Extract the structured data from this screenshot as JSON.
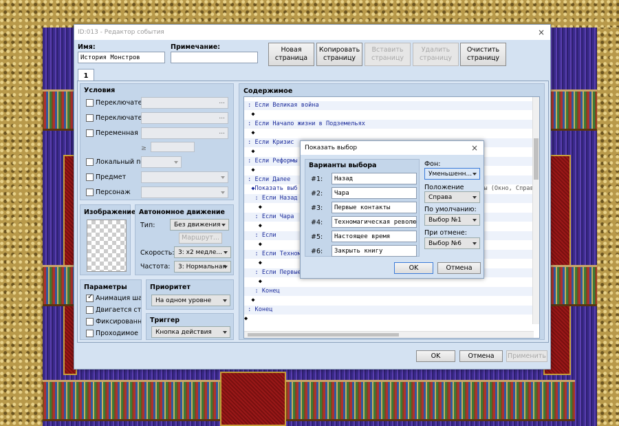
{
  "window": {
    "title": "ID:013 - Редактор события",
    "close": "×"
  },
  "name": {
    "label": "Имя:",
    "value": "История Монстров"
  },
  "note": {
    "label": "Примечание:",
    "value": ""
  },
  "page_buttons": [
    {
      "label": "Новая\nстраница",
      "enabled": true
    },
    {
      "label": "Копировать\nстраницу",
      "enabled": true
    },
    {
      "label": "Вставить\nстраницу",
      "enabled": false
    },
    {
      "label": "Удалить\nстраницу",
      "enabled": false
    },
    {
      "label": "Очистить\nстраницу",
      "enabled": true
    }
  ],
  "tab": "1",
  "conditions": {
    "title": "Условия",
    "switch1": "Переключатель",
    "switch2": "Переключатель",
    "variable": "Переменная",
    "ge": "≥",
    "self_switch": "Локальный пере",
    "item": "Предмет",
    "actor": "Персонаж",
    "dots": "..."
  },
  "image": {
    "title": "Изображение"
  },
  "autonomous": {
    "title": "Автономное движение",
    "type_label": "Тип:",
    "type_value": "Без движения",
    "route": "Маршрут...",
    "speed_label": "Скорость:",
    "speed_value": "3: x2 медле...",
    "freq_label": "Частота:",
    "freq_value": "3: Нормальная"
  },
  "options": {
    "title": "Параметры",
    "items": [
      {
        "label": "Анимация шага",
        "checked": true
      },
      {
        "label": "Двигается стоя",
        "checked": false
      },
      {
        "label": "Фиксированное",
        "checked": false
      },
      {
        "label": "Проходимое",
        "checked": false
      }
    ]
  },
  "priority": {
    "title": "Приоритет",
    "value": "На одном уровне"
  },
  "trigger": {
    "title": "Триггер",
    "value": "Кнопка действия"
  },
  "contents": {
    "title": "Содержимое",
    "rows": [
      {
        "text": "  ◆",
        "bul": true
      },
      {
        "text": " : Если Великая война"
      },
      {
        "text": "  ◆",
        "bul": true
      },
      {
        "text": " : Если Начало жизни в Подземельях"
      },
      {
        "text": "  ◆",
        "bul": true
      },
      {
        "text": " : Если Кризис"
      },
      {
        "text": "  ◆",
        "bul": true
      },
      {
        "text": " : Если Реформы к"
      },
      {
        "text": "  ◆",
        "bul": true
      },
      {
        "text": " : Если Далее"
      },
      {
        "text": "  ◆Показать выб",
        "tail": "кты (Окно, Справ"
      },
      {
        "text": "   : Если Назад"
      },
      {
        "text": "    ◆",
        "bul": true
      },
      {
        "text": "   : Если Чара"
      },
      {
        "text": "    ◆",
        "bul": true
      },
      {
        "text": "   : Если"
      },
      {
        "text": "    ◆",
        "bul": true
      },
      {
        "text": "   : Если Техномa"
      },
      {
        "text": "    ◆",
        "bul": true
      },
      {
        "text": "   : Если Первые контакты"
      },
      {
        "text": "    ◆",
        "bul": true
      },
      {
        "text": "   : Конец"
      },
      {
        "text": "  ◆",
        "bul": true
      },
      {
        "text": " : Конец"
      },
      {
        "text": "◆",
        "bul": true
      }
    ]
  },
  "footer": {
    "ok": "OK",
    "cancel": "Отмена",
    "apply": "Применить"
  },
  "choice_dialog": {
    "title": "Показать выбор",
    "close": "×",
    "choices_title": "Варианты выбора",
    "choices": [
      {
        "num": "#1:",
        "value": "Назад"
      },
      {
        "num": "#2:",
        "value": "Чара"
      },
      {
        "num": "#3:",
        "value": "Первые контакты"
      },
      {
        "num": "#4:",
        "value": "Техномагическая революция"
      },
      {
        "num": "#5:",
        "value": "Настоящее время"
      },
      {
        "num": "#6:",
        "value": "Закрыть книгу"
      }
    ],
    "bg_label": "Фон:",
    "bg_value": "Уменьшенн...",
    "pos_label": "Положение окна:",
    "pos_value": "Справа",
    "default_label": "По умолчанию:",
    "default_value": "Выбор №1",
    "cancel_label": "При отмене:",
    "cancel_value": "Выбор №6",
    "ok": "OK",
    "cancel": "Отмена"
  },
  "colors": {
    "accent": "#3a7ad8",
    "list_text": "#1a2a9a"
  }
}
